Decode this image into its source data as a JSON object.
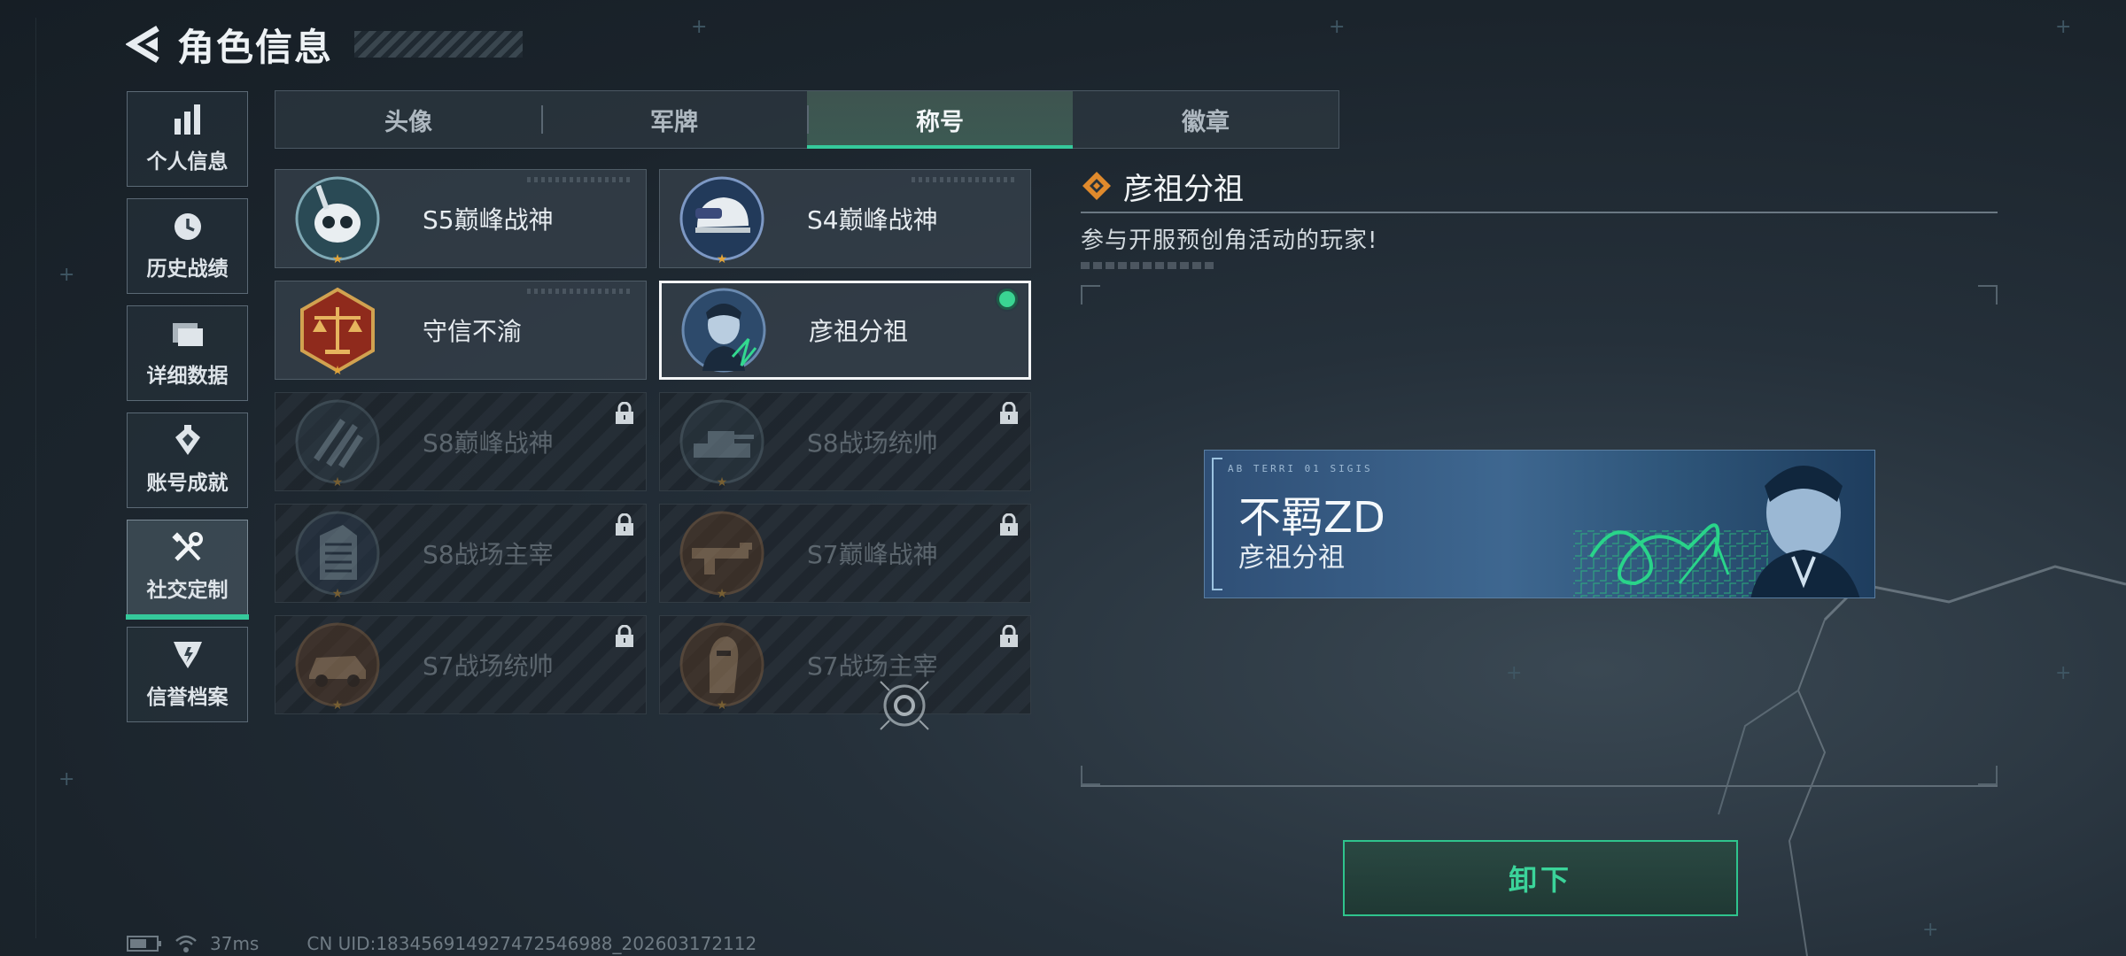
{
  "header": {
    "title": "角色信息",
    "back_icon": "back-arrow-icon"
  },
  "sidebar": {
    "items": [
      {
        "label": "个人信息",
        "icon": "bar-chart-icon",
        "active": false
      },
      {
        "label": "历史战绩",
        "icon": "clock-history-icon",
        "active": false
      },
      {
        "label": "详细数据",
        "icon": "folder-stack-icon",
        "active": false
      },
      {
        "label": "账号成就",
        "icon": "achievement-emblem-icon",
        "active": false
      },
      {
        "label": "社交定制",
        "icon": "tools-wrench-icon",
        "active": true
      },
      {
        "label": "信誉档案",
        "icon": "shield-badge-icon",
        "active": false
      }
    ]
  },
  "tabs": [
    {
      "label": "头像",
      "active": false
    },
    {
      "label": "军牌",
      "active": false
    },
    {
      "label": "称号",
      "active": true
    },
    {
      "label": "徽章",
      "active": false
    }
  ],
  "titles": [
    {
      "name": "S5巅峰战神",
      "locked": false,
      "selected": false,
      "badge": "skull-diver-badge"
    },
    {
      "name": "S4巅峰战神",
      "locked": false,
      "selected": false,
      "badge": "helmet-nightvision-badge"
    },
    {
      "name": "守信不渝",
      "locked": false,
      "selected": false,
      "badge": "scales-of-justice-badge"
    },
    {
      "name": "彦祖分祖",
      "locked": false,
      "selected": true,
      "badge": "portrait-badge"
    },
    {
      "name": "S8巅峰战神",
      "locked": true,
      "selected": false,
      "badge": "slash-emblem-badge"
    },
    {
      "name": "S8战场统帅",
      "locked": true,
      "selected": false,
      "badge": "tank-badge"
    },
    {
      "name": "S8战场主宰",
      "locked": true,
      "selected": false,
      "badge": "building-badge"
    },
    {
      "name": "S7巅峰战神",
      "locked": true,
      "selected": false,
      "badge": "gun-badge"
    },
    {
      "name": "S7战场统帅",
      "locked": true,
      "selected": false,
      "badge": "vehicle-badge"
    },
    {
      "name": "S7战场主宰",
      "locked": true,
      "selected": false,
      "badge": "warrior-badge"
    }
  ],
  "detail": {
    "title": "彦祖分祖",
    "description": "参与开服预创角活动的玩家!"
  },
  "nameplate": {
    "code": "AB TERRI 01 SIGIS",
    "player": "不羁ZD",
    "title": "彦祖分祖"
  },
  "actions": {
    "unequip_label": "卸下"
  },
  "status": {
    "ping": "37ms",
    "uid": "CN UID:18345691492747254698​8_202603172112"
  },
  "colors": {
    "accent": "#35c99b",
    "button_text": "#3bd49a",
    "equipped": "#3ad492"
  }
}
